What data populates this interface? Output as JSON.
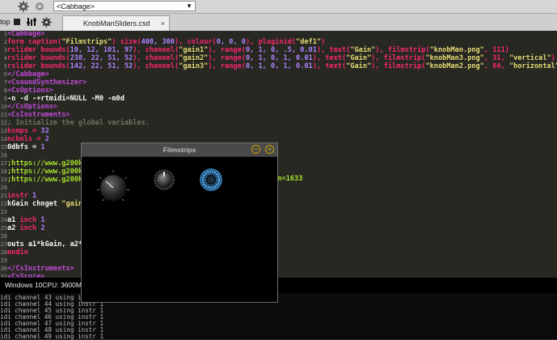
{
  "toolbar": {
    "combo_value": "<Cabbage>"
  },
  "tabbar": {
    "stop_label": "top",
    "tab_label": "KnobManSliders.csd",
    "tab_close": "×"
  },
  "editor": {
    "lines": [
      {
        "n": "1",
        "segs": [
          [
            "tag",
            "<Cabbage>"
          ]
        ]
      },
      {
        "n": "2",
        "segs": [
          [
            "kw",
            "form caption("
          ],
          [
            "str",
            "\"Filmstrips\""
          ],
          [
            "kw",
            ") size("
          ],
          [
            "num",
            "400, 300"
          ],
          [
            "kw",
            "), colour("
          ],
          [
            "num",
            "0, 0, 0"
          ],
          [
            "kw",
            "), pluginid("
          ],
          [
            "str",
            "\"def1\""
          ],
          [
            "kw",
            ")"
          ]
        ]
      },
      {
        "n": "3",
        "segs": [
          [
            "kw",
            "rslider bounds("
          ],
          [
            "num",
            "10, 12, 101, 97"
          ],
          [
            "kw",
            "), channel("
          ],
          [
            "str",
            "\"gain1\""
          ],
          [
            "kw",
            "), range("
          ],
          [
            "num",
            "0, 1, 0, .5, 0.01"
          ],
          [
            "kw",
            "), text("
          ],
          [
            "str",
            "\"Gain\""
          ],
          [
            "kw",
            "), filmstrip("
          ],
          [
            "str",
            "\"knobMan.png\""
          ],
          [
            "kw",
            ", 111)"
          ]
        ]
      },
      {
        "n": "4",
        "segs": [
          [
            "kw",
            "rslider bounds("
          ],
          [
            "num",
            "238, 22, 51, 52"
          ],
          [
            "kw",
            "), channel("
          ],
          [
            "str",
            "\"gain2\""
          ],
          [
            "kw",
            "), range("
          ],
          [
            "num",
            "0, 1, 0, 1, 0.01"
          ],
          [
            "kw",
            "), text("
          ],
          [
            "str",
            "\"Gain\""
          ],
          [
            "kw",
            "), filmstrip("
          ],
          [
            "str",
            "\"knobMan3.png\""
          ],
          [
            "kw",
            ", 31, "
          ],
          [
            "str",
            "\"vertical\""
          ],
          [
            "kw",
            ")"
          ]
        ]
      },
      {
        "n": "5",
        "segs": [
          [
            "kw",
            "rslider bounds("
          ],
          [
            "num",
            "142, 22, 51, 52"
          ],
          [
            "kw",
            "), channel("
          ],
          [
            "str",
            "\"gain3\""
          ],
          [
            "kw",
            "), range("
          ],
          [
            "num",
            "0, 1, 0, 1, 0.01"
          ],
          [
            "kw",
            "), text("
          ],
          [
            "str",
            "\"Gain\""
          ],
          [
            "kw",
            "), filmstrip("
          ],
          [
            "str",
            "\"knobMan2.png\""
          ],
          [
            "kw",
            ", 64, "
          ],
          [
            "str",
            "\"horizontal\""
          ],
          [
            "kw",
            ")"
          ]
        ]
      },
      {
        "n": "6",
        "segs": [
          [
            "tag",
            "</Cabbage>"
          ]
        ]
      },
      {
        "n": "7",
        "segs": [
          [
            "tag",
            "<CsoundSynthesizer>"
          ]
        ]
      },
      {
        "n": "8",
        "segs": [
          [
            "tag",
            "<CsOptions>"
          ]
        ]
      },
      {
        "n": "9",
        "segs": [
          [
            "plain",
            "-n -d -+rtmidi=NULL -M0 -m0d"
          ]
        ]
      },
      {
        "n": "10",
        "segs": [
          [
            "tag",
            "</CsOptions>"
          ]
        ]
      },
      {
        "n": "11",
        "segs": [
          [
            "tag",
            "<CsInstruments>"
          ]
        ]
      },
      {
        "n": "12",
        "segs": [
          [
            "cmt",
            "; Initialize the global variables."
          ]
        ]
      },
      {
        "n": "13",
        "segs": [
          [
            "kw",
            "ksmps = "
          ],
          [
            "num",
            "32"
          ]
        ]
      },
      {
        "n": "14",
        "segs": [
          [
            "kw",
            "nchnls = "
          ],
          [
            "num",
            "2"
          ]
        ]
      },
      {
        "n": "15",
        "segs": [
          [
            "plain",
            "0dbfs = "
          ],
          [
            "num",
            "1"
          ]
        ]
      },
      {
        "n": "16",
        "segs": [
          [
            "plain",
            ""
          ]
        ]
      },
      {
        "n": "17",
        "segs": [
          [
            "url",
            ";https://www.g200k"
          ]
        ]
      },
      {
        "n": "18",
        "segs": [
          [
            "url",
            ";https://www.g200k"
          ]
        ]
      },
      {
        "n": "19",
        "segs": [
          [
            "url",
            ";https://www.g200k"
          ]
        ]
      },
      {
        "n": "20",
        "segs": [
          [
            "plain",
            ""
          ]
        ]
      },
      {
        "n": "21",
        "segs": [
          [
            "kw",
            "instr "
          ],
          [
            "num",
            "1"
          ]
        ]
      },
      {
        "n": "22",
        "segs": [
          [
            "plain",
            "kGain chnget "
          ],
          [
            "str",
            "\"gain"
          ]
        ]
      },
      {
        "n": "23",
        "segs": [
          [
            "plain",
            ""
          ]
        ]
      },
      {
        "n": "24",
        "segs": [
          [
            "plain",
            "a1 "
          ],
          [
            "kw",
            "inch "
          ],
          [
            "num",
            "1"
          ]
        ]
      },
      {
        "n": "25",
        "segs": [
          [
            "plain",
            "a2 "
          ],
          [
            "kw",
            "inch "
          ],
          [
            "num",
            "2"
          ]
        ]
      },
      {
        "n": "26",
        "segs": [
          [
            "plain",
            ""
          ]
        ]
      },
      {
        "n": "27",
        "segs": [
          [
            "plain",
            "outs a1*kGain, a2*"
          ]
        ]
      },
      {
        "n": "28",
        "segs": [
          [
            "kw",
            "endin"
          ]
        ]
      },
      {
        "n": "29",
        "segs": [
          [
            "plain",
            ""
          ]
        ]
      },
      {
        "n": "30",
        "segs": [
          [
            "tag",
            "</CsInstruments>"
          ]
        ]
      },
      {
        "n": "31",
        "segs": [
          [
            "tag",
            "<CsScore>"
          ]
        ]
      }
    ],
    "hidden_url_tail_1": "25",
    "hidden_url_tail_2": "b&n=1633"
  },
  "console": {
    "header": "Windows 10CPU: 3600MHz",
    "lines": [
      "idi channel 43 using instr 1",
      "idi channel 44 using instr 1",
      "idi channel 45 using instr 1",
      "idi channel 46 using instr 1",
      "idi channel 47 using instr 1",
      "idi channel 48 using instr 1",
      "idi channel 49 using instr 1"
    ]
  },
  "popup": {
    "title": "Filmstrips",
    "minimize": "−",
    "close": "×"
  },
  "colors": {
    "tag": "#c24bd9",
    "keyword": "#f92672",
    "string": "#e6db74",
    "number": "#ae81ff",
    "comment": "#75715e",
    "url": "#a6e22e"
  }
}
